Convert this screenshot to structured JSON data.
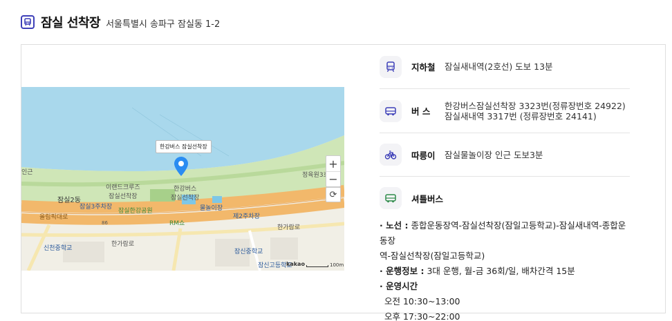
{
  "header": {
    "title": "잠실 선착장",
    "address": "서울특별시 송파구 잠실동 1-2",
    "icon": "bus-stop-icon"
  },
  "map": {
    "tooltip": "한강버스 잠실선착장",
    "labels": {
      "lotte": "이랜드크루즈\n잠실선착장",
      "hangang_bus": "한강버스\n잠실선착장",
      "jamsil2": "잠실2동",
      "parking3": "잠실3주차장",
      "park": "잠실한강공원",
      "rm": "RM쇼",
      "water": "물놀이장",
      "parking2": "제2주차장",
      "jeong": "정육원3호",
      "olympic": "올림픽대로",
      "hangang_ro": "한가람로",
      "sinsae_school": "신천중학교",
      "jamsin_high": "잠신고등학교",
      "jamsin_mid": "잠신중학교",
      "road86": "86",
      "left_edge": "인근",
      "hangang_ro2": "한가람로"
    },
    "zoom_in": "+",
    "zoom_out": "−",
    "refresh": "⟳",
    "attribution": "kakao",
    "scale": "100m"
  },
  "transport": {
    "subway": {
      "icon": "subway-icon",
      "label": "지하철",
      "value": "잠실새내역(2호선) 도보 13분"
    },
    "bus": {
      "icon": "bus-icon",
      "label": "버 스",
      "value_line1": "한강버스잠실선착장 3323번(정류장번호 24922)",
      "value_line2": "잠실새내역 3317번 (정류장번호 24141)"
    },
    "bike": {
      "icon": "bicycle-icon",
      "label": "따릉이",
      "value": "잠실물놀이장 인근 도보3분"
    },
    "shuttle": {
      "icon": "shuttle-bus-icon",
      "label": "셔틀버스",
      "route_label": "· 노선 :",
      "route_value": "종합운동장역-잠실선착장(잠일고등학교)-잠실새내역-종합운동장",
      "route_value2": "역-잠실선착장(잠일고등학교)",
      "info_label": "· 운행정보 :",
      "info_value": "3대 운행, 월-금 36회/일, 배차간격 15분",
      "time_label": "· 운영시간",
      "am": "오전 10:30~13:00",
      "pm": "오후 17:30~22:00"
    }
  },
  "colors": {
    "accent": "#3d3fb8",
    "river": "#a9d8ec",
    "park": "#c9e3b0",
    "road": "#f0b86a",
    "pin": "#2a8cf2"
  }
}
